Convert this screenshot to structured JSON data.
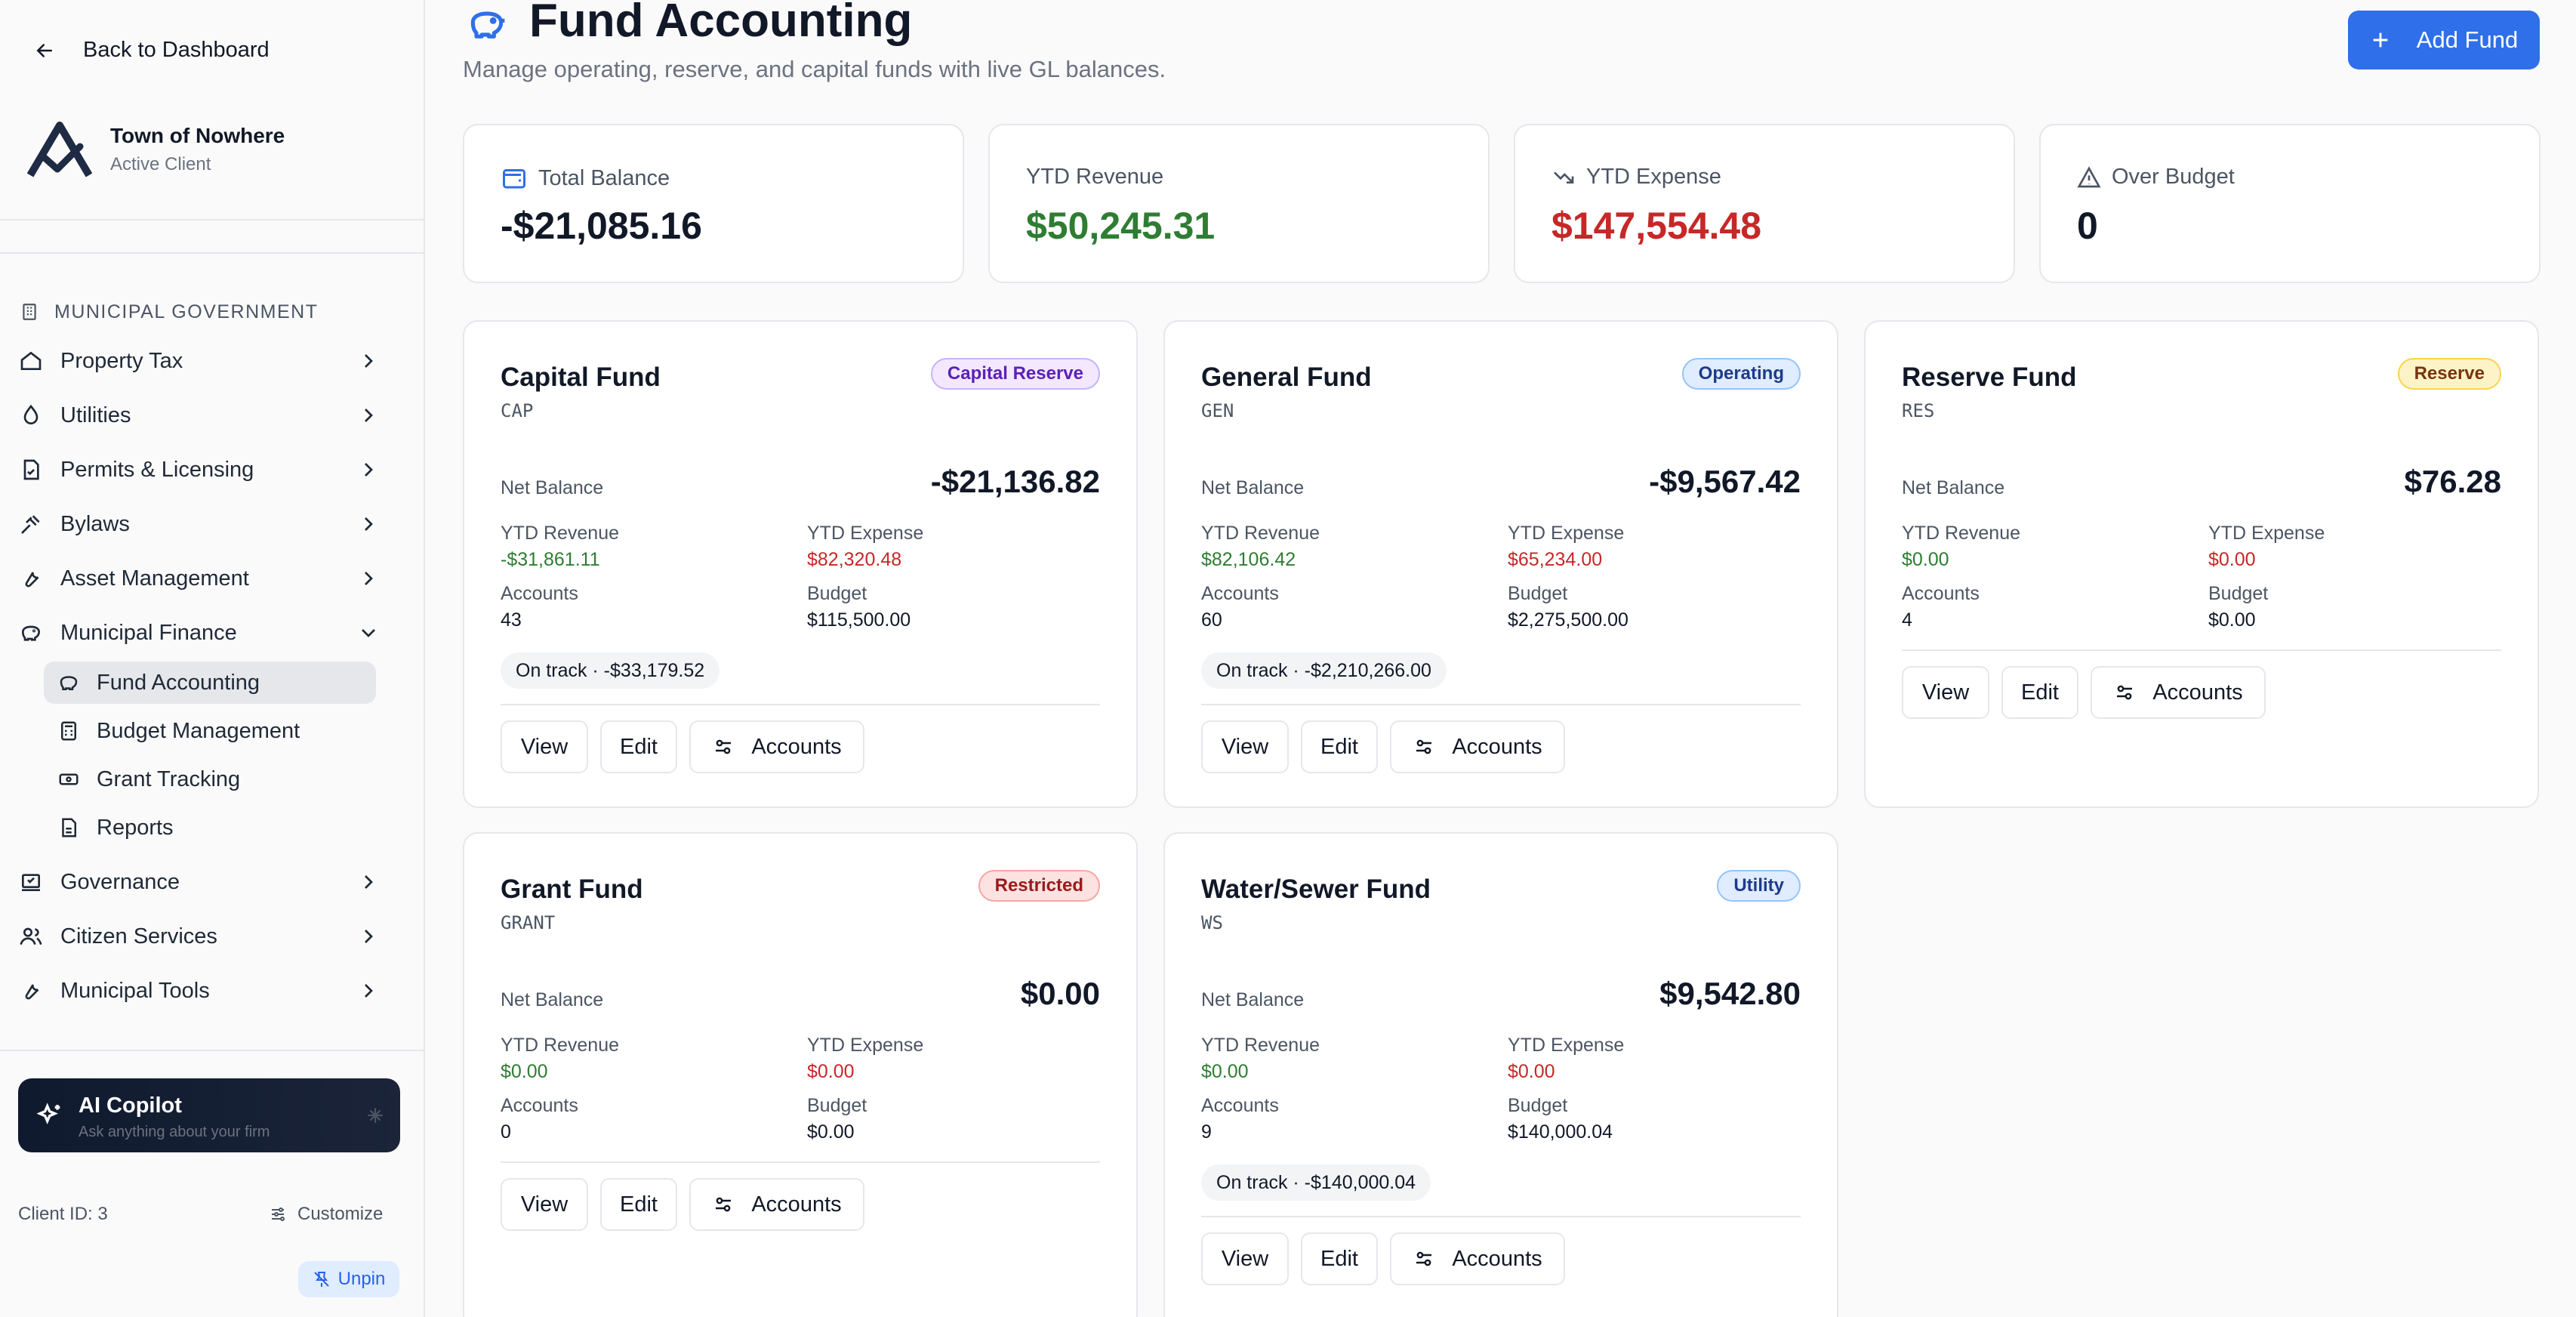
{
  "sidebar": {
    "back_label": "Back to Dashboard",
    "client_name": "Town of Nowhere",
    "client_status": "Active Client",
    "section_label": "MUNICIPAL GOVERNMENT",
    "items": [
      {
        "label": "Property Tax"
      },
      {
        "label": "Utilities"
      },
      {
        "label": "Permits & Licensing"
      },
      {
        "label": "Bylaws"
      },
      {
        "label": "Asset Management"
      },
      {
        "label": "Municipal Finance"
      },
      {
        "label": "Governance"
      },
      {
        "label": "Citizen Services"
      },
      {
        "label": "Municipal Tools"
      }
    ],
    "finance_sub": [
      {
        "label": "Fund Accounting"
      },
      {
        "label": "Budget Management"
      },
      {
        "label": "Grant Tracking"
      },
      {
        "label": "Reports"
      }
    ],
    "copilot_title": "AI Copilot",
    "copilot_sub": "Ask anything about your firm",
    "client_id": "Client ID: 3",
    "customize": "Customize",
    "unpin": "Unpin"
  },
  "header": {
    "title": "Fund Accounting",
    "subtitle": "Manage operating, reserve, and capital funds with live GL balances.",
    "add_button": "Add Fund"
  },
  "stats": [
    {
      "label": "Total Balance",
      "value": "-$21,085.16"
    },
    {
      "label": "YTD Revenue",
      "value": "$50,245.31"
    },
    {
      "label": "YTD Expense",
      "value": "$147,554.48"
    },
    {
      "label": "Over Budget",
      "value": "0"
    }
  ],
  "labels": {
    "net_balance": "Net Balance",
    "ytd_revenue": "YTD Revenue",
    "ytd_expense": "YTD Expense",
    "accounts": "Accounts",
    "budget": "Budget",
    "view": "View",
    "edit": "Edit",
    "accounts_btn": "Accounts"
  },
  "funds": [
    {
      "name": "Capital Fund",
      "code": "CAP",
      "badge": "Capital Reserve",
      "net": "-$21,136.82",
      "rev": "-$31,861.11",
      "exp": "$82,320.48",
      "accounts": "43",
      "budget": "$115,500.00",
      "status": "On track · -$33,179.52"
    },
    {
      "name": "General Fund",
      "code": "GEN",
      "badge": "Operating",
      "net": "-$9,567.42",
      "rev": "$82,106.42",
      "exp": "$65,234.00",
      "accounts": "60",
      "budget": "$2,275,500.00",
      "status": "On track · -$2,210,266.00"
    },
    {
      "name": "Reserve Fund",
      "code": "RES",
      "badge": "Reserve",
      "net": "$76.28",
      "rev": "$0.00",
      "exp": "$0.00",
      "accounts": "4",
      "budget": "$0.00",
      "status": ""
    },
    {
      "name": "Grant Fund",
      "code": "GRANT",
      "badge": "Restricted",
      "net": "$0.00",
      "rev": "$0.00",
      "exp": "$0.00",
      "accounts": "0",
      "budget": "$0.00",
      "status": ""
    },
    {
      "name": "Water/Sewer Fund",
      "code": "WS",
      "badge": "Utility",
      "net": "$9,542.80",
      "rev": "$0.00",
      "exp": "$0.00",
      "accounts": "9",
      "budget": "$140,000.04",
      "status": "On track · -$140,000.04"
    }
  ],
  "badge_colors": {
    "capital": "#f3e8ff",
    "operating": "#e0ecff",
    "reserve": "#fef3c7",
    "restricted": "#fde2e2",
    "utility": "#e0ecff"
  }
}
